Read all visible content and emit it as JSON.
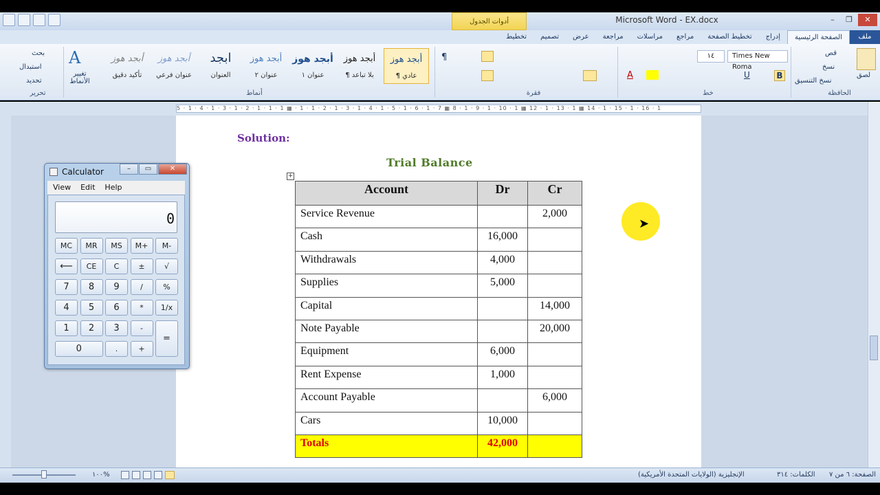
{
  "window": {
    "title": "Microsoft Word  -  EX.docx",
    "context_tab": "أدوات الجدول",
    "controls": [
      "–",
      "❐",
      "✕"
    ]
  },
  "ribbon_tabs": [
    "ملف",
    "الصفحة الرئيسية",
    "إدراج",
    "تخطيط الصفحة",
    "مراجع",
    "مراسلات",
    "مراجعة",
    "عرض",
    "تصميم",
    "تخطيط"
  ],
  "ribbon": {
    "clipboard": {
      "paste": "لصق",
      "cut": "قص",
      "copy": "نسخ",
      "format_painter": "نسخ التنسيق",
      "label": "الحافظة"
    },
    "font": {
      "name": "Times New Roma",
      "size": "١٤",
      "label": "خط"
    },
    "paragraph": {
      "label": "فقرة"
    },
    "styles": {
      "label": "أنماط",
      "items": [
        {
          "sample": "أبجد هوز",
          "name": "¶ عادي"
        },
        {
          "sample": "أبجد هوز",
          "name": "¶ بلا تباعد"
        },
        {
          "sample": "أبجد هوز",
          "name": "عنوان ١"
        },
        {
          "sample": "أبجد هوز",
          "name": "عنوان ٢"
        },
        {
          "sample": "ابجد",
          "name": "العنوان"
        },
        {
          "sample": "أبجد هوز",
          "name": "عنوان فرعي"
        },
        {
          "sample": "أبجد هوز",
          "name": "تأكيد دقيق"
        }
      ],
      "change_styles": "تغيير الأنماط"
    },
    "editing": {
      "find": "بحث",
      "replace": "استبدال",
      "select": "تحديد",
      "label": "تحرير"
    }
  },
  "ruler": "5 · 1 · 4 · 1 · 3 · 1 · 2 · 1 · 1 · 1 ▦ · 1 · 1 · 2 · 1 · 3 · 1 · 4 · 1 · 5 · 1 · 6 · 1 · 7 ▦ 8 · 1 · 9 · 1 · 10 · 1 ▦ 12 · 1 · 13 · 1 ▦ 14 · 1 · 15 · 1 · 16 · 1",
  "document": {
    "heading": "Solution:",
    "title": "Trial  Balance",
    "table": {
      "headers": [
        "Account",
        "Dr",
        "Cr"
      ],
      "rows": [
        [
          "Service Revenue",
          "",
          "2,000"
        ],
        [
          "Cash",
          "16,000",
          ""
        ],
        [
          "Withdrawals",
          "4,000",
          ""
        ],
        [
          "Supplies",
          "5,000",
          ""
        ],
        [
          "Capital",
          "",
          "14,000"
        ],
        [
          "Note Payable",
          "",
          "20,000"
        ],
        [
          "Equipment",
          "6,000",
          ""
        ],
        [
          "Rent Expense",
          "1,000",
          ""
        ],
        [
          "Account Payable",
          "",
          "6,000"
        ],
        [
          "Cars",
          "10,000",
          ""
        ]
      ],
      "total": [
        "Totals",
        "42,000",
        ""
      ]
    }
  },
  "calculator": {
    "title": "Calculator",
    "menu": [
      "View",
      "Edit",
      "Help"
    ],
    "display": "0",
    "keys": [
      [
        "MC",
        "MR",
        "MS",
        "M+",
        "M-"
      ],
      [
        "⟵",
        "CE",
        "C",
        "±",
        "√"
      ],
      [
        "7",
        "8",
        "9",
        "/",
        "%"
      ],
      [
        "4",
        "5",
        "6",
        "*",
        "1/x"
      ],
      [
        "1",
        "2",
        "3",
        "-",
        "="
      ],
      [
        "0",
        ".",
        "+"
      ]
    ]
  },
  "statusbar": {
    "page": "الصفحة: ٦ من ٧",
    "words": "الكلمات: ٣١٤",
    "language": "الإنجليزية (الولايات المتحدة الأمريكية)",
    "zoom": "١٠٠%"
  },
  "colors": {
    "heading": "#7030a0",
    "title": "#4f7a28",
    "totals_bg": "#ffff00",
    "totals_text": "#e00000",
    "header_bg": "#d9d9d9"
  }
}
